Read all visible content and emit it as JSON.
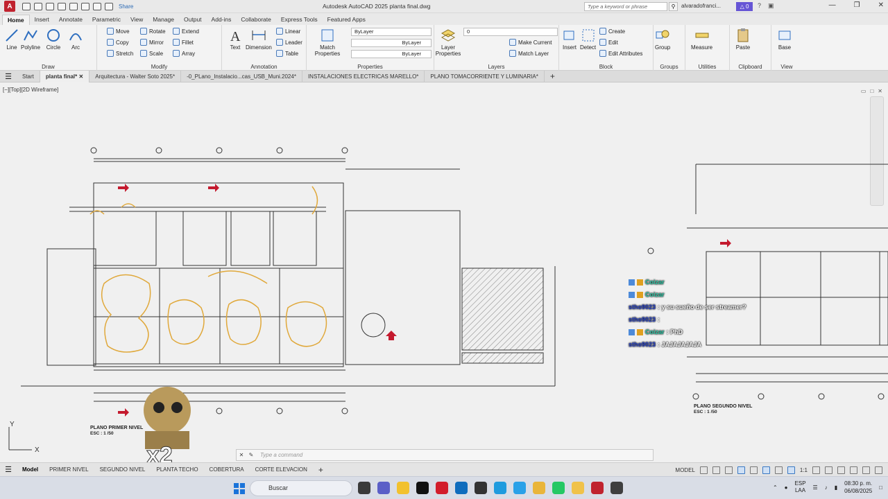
{
  "window": {
    "title": "Autodesk AutoCAD 2025    planta final.dwg",
    "share_label": "Share",
    "search_placeholder": "Type a keyword or phrase",
    "user": "alvaradofranci...",
    "notif_count": "0"
  },
  "ribbon_tabs": [
    "Home",
    "Insert",
    "Annotate",
    "Parametric",
    "View",
    "Manage",
    "Output",
    "Add-ins",
    "Collaborate",
    "Express Tools",
    "Featured Apps"
  ],
  "ribbon": {
    "draw": {
      "label": "Draw",
      "line": "Line",
      "polyline": "Polyline",
      "circle": "Circle",
      "arc": "Arc"
    },
    "modify": {
      "label": "Modify",
      "move": "Move",
      "rotate": "Rotate",
      "extend": "Extend",
      "copy": "Copy",
      "mirror": "Mirror",
      "fillet": "Fillet",
      "stretch": "Stretch",
      "scale": "Scale",
      "array": "Array"
    },
    "annotation": {
      "label": "Annotation",
      "text": "Text",
      "dimension": "Dimension",
      "linear": "Linear",
      "leader": "Leader",
      "table": "Table"
    },
    "properties": {
      "label": "Properties",
      "match": "Match Properties",
      "color": "ByLayer",
      "linetype": "ByLayer",
      "lineweight": "ByLayer"
    },
    "layers": {
      "label": "Layers",
      "layer_props": "Layer Properties",
      "current_layer": "0",
      "make_current": "Make Current",
      "match_layer": "Match Layer"
    },
    "block": {
      "label": "Block",
      "insert": "Insert",
      "detect": "Detect",
      "create": "Create",
      "edit": "Edit",
      "edit_attr": "Edit Attributes"
    },
    "groups": {
      "label": "Groups",
      "group": "Group"
    },
    "utilities": {
      "label": "Utilities",
      "measure": "Measure"
    },
    "clipboard": {
      "label": "Clipboard",
      "paste": "Paste"
    },
    "view": {
      "label": "View",
      "base": "Base"
    }
  },
  "doc_tabs": [
    "Start",
    "planta final*",
    "Arquitectura - Walter Soto 2025*",
    "-0_PLano_Instalacio...cas_USB_Muni.2024*",
    "INSTALACIONES ELECTRICAS MARELLO*",
    "PLANO TOMACORRIENTE Y LUMINARIA*"
  ],
  "viewport_label": "[−][Top][2D Wireframe]",
  "drawing": {
    "plan1_title": "PLANO PRIMER NIVEL",
    "plan1_scale": "ESC : 1 /50",
    "plan2_title": "PLANO SEGUNDO NIVEL",
    "plan2_scale": "ESC : 1 /50",
    "ucs_y": "Y",
    "ucs_x": "X"
  },
  "chat": [
    {
      "user": "Coizar",
      "msg": ""
    },
    {
      "user": "Coizar",
      "msg": ""
    },
    {
      "user": "stho9023",
      "msg": ": y su sueño de ser streamer?"
    },
    {
      "user": "stho9023",
      "msg": ":"
    },
    {
      "user": "Coizar",
      "msg": ": PhD"
    },
    {
      "user": "stho9023",
      "msg": ": JAJAJAJAJA"
    }
  ],
  "overlay_multiplier": "x2",
  "command_placeholder": "Type a command",
  "layout_tabs": [
    "Model",
    "PRIMER NIVEL",
    "SEGUNDO NIVEL",
    "PLANTA TECHO",
    "COBERTURA",
    "CORTE ELEVACION"
  ],
  "status": {
    "mode": "MODEL",
    "scale": "1:1"
  },
  "taskbar": {
    "search": "Buscar",
    "lang1": "ESP",
    "lang2": "LAA",
    "time": "08:30 p. m.",
    "date": "06/08/2025"
  }
}
